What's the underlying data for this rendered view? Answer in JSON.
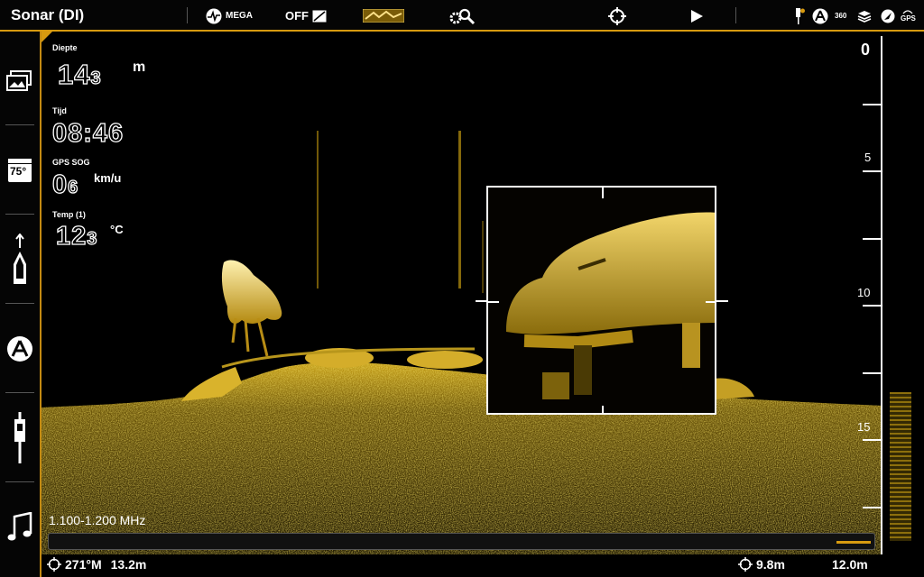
{
  "topbar": {
    "title": "Sonar (DI)",
    "mega_label": "MEGA",
    "off_label": "OFF",
    "status_360": "360",
    "status_gps": "GPS"
  },
  "sidebar": {
    "items": [
      "window-icon",
      "temperature-icon",
      "boat-icon",
      "chart-icon",
      "transducer-icon",
      "music-icon"
    ],
    "temp_icon_text": "75°"
  },
  "readouts": [
    {
      "label": "Diepte",
      "value": "14",
      "decimal": "3",
      "unit": "m"
    },
    {
      "label": "Tijd",
      "value": "08:46",
      "decimal": "",
      "unit": ""
    },
    {
      "label": "GPS SOG",
      "value": "0",
      "decimal": "6",
      "unit": "km/u"
    },
    {
      "label": "Temp (1)",
      "value": "12",
      "decimal": "3",
      "unit": "°C"
    }
  ],
  "frequency": "1.100-1.200 MHz",
  "bottom": {
    "cursor_bearing": "271°M",
    "cursor_distance": "13.2m",
    "cursor_depth": "9.8m",
    "range": "12.0m"
  },
  "depth_scale": {
    "labels": [
      "0",
      "5",
      "10",
      "15"
    ],
    "max": 20
  },
  "colors": {
    "accent": "#d79a10",
    "sonar": "#c9a21a"
  }
}
